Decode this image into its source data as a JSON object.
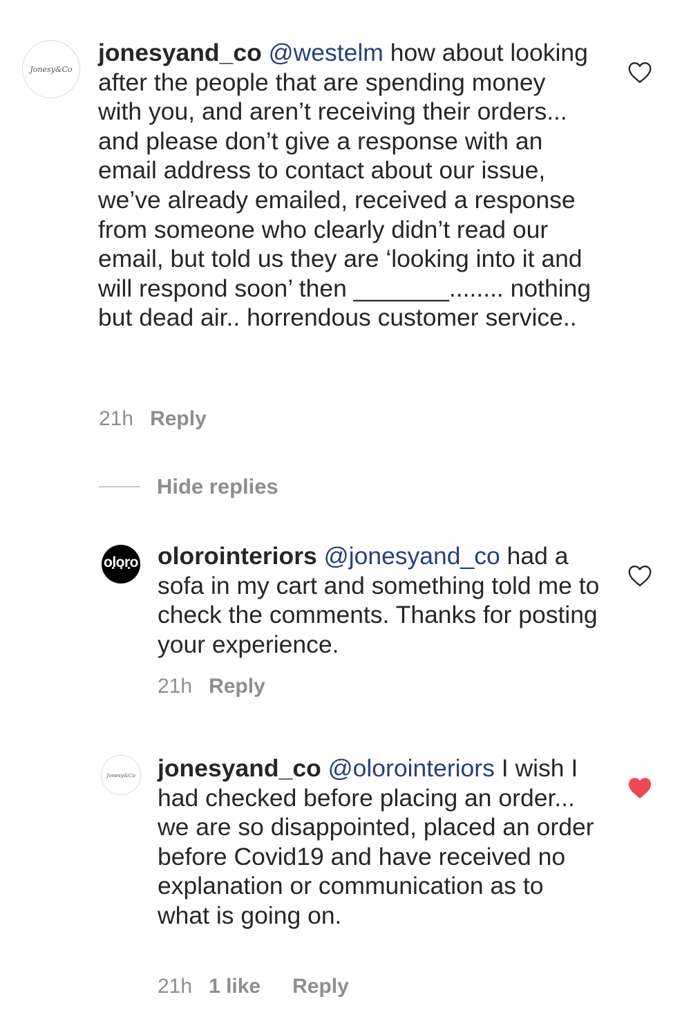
{
  "comments": [
    {
      "username": "jonesyand_co",
      "avatar_text": "Jonesy&Co",
      "mention": "@westelm",
      "text": " how about looking after the people that are spending money with you, and aren’t receiving their orders... and please don’t give a response with an email address to contact about our issue, we’ve already emailed, received a response from someone who clearly didn’t read our email, but told us they are ‘looking into it and will respond soon’ then _______........ nothing but dead air.. horrendous customer service..",
      "time": "21h",
      "reply_label": "Reply",
      "liked": false
    },
    {
      "username": "olorointeriors",
      "avatar_text": "oloro",
      "mention": "@jonesyand_co",
      "text": " had a sofa in my cart and something told me to check the comments. Thanks for posting your experience.",
      "time": "21h",
      "reply_label": "Reply",
      "liked": false
    },
    {
      "username": "jonesyand_co",
      "avatar_text": "Jonesy&Co",
      "mention": "@olorointeriors",
      "text": " I wish I had checked before placing an order... we are so disappointed, placed an order before Covid19 and have received no explanation or communication as to what is going on.",
      "time": "21h",
      "likes": "1 like",
      "reply_label": "Reply",
      "liked": true
    }
  ],
  "hide_replies_label": "Hide replies",
  "colors": {
    "text": "#262626",
    "mention": "#27417a",
    "meta": "#8e8e8e",
    "heart_liked": "#ed4956",
    "heart_outline": "#262626"
  }
}
